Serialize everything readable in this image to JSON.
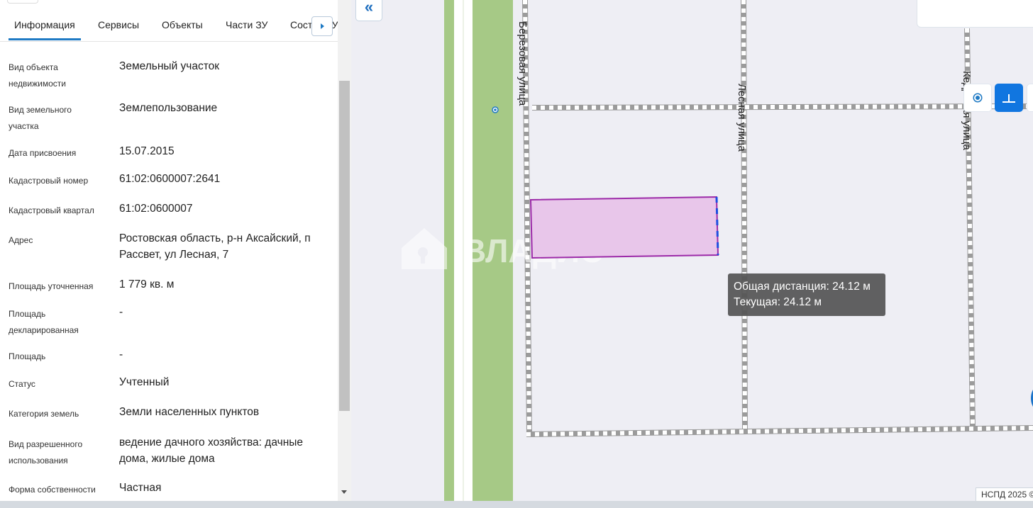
{
  "tabs": [
    {
      "label": "Информация"
    },
    {
      "label": "Сервисы"
    },
    {
      "label": "Объекты"
    },
    {
      "label": "Части ЗУ"
    },
    {
      "label": "Состав ЗУ"
    }
  ],
  "info": {
    "rows": [
      {
        "label": "Вид объекта недвижимости",
        "value": "Земельный участок"
      },
      {
        "label": "Вид земельного участка",
        "value": "Землепользование"
      },
      {
        "label": "Дата присвоения",
        "value": "15.07.2015"
      },
      {
        "label": "Кадастровый номер",
        "value": "61:02:0600007:2641"
      },
      {
        "label": "Кадастровый квартал",
        "value": "61:02:0600007"
      },
      {
        "label": "Адрес",
        "value": "Ростовская область, р-н Аксайский, п Рассвет, ул Лесная, 7"
      },
      {
        "label": "Площадь уточненная",
        "value": "1 779 кв. м"
      },
      {
        "label": "Площадь декларированная",
        "value": "-"
      },
      {
        "label": "Площадь",
        "value": "-"
      },
      {
        "label": "Статус",
        "value": "Учтенный"
      },
      {
        "label": "Категория земель",
        "value": "Земли населенных пунктов"
      },
      {
        "label": "Вид разрешенного использования",
        "value": "ведение дачного хозяйства: дачные дома, жилые дома"
      },
      {
        "label": "Форма собственности",
        "value": "Частная"
      }
    ]
  },
  "map": {
    "streets": [
      {
        "name": "Березовая улица"
      },
      {
        "name": "Лесная улица"
      },
      {
        "name": "Кедровая улица"
      }
    ],
    "watermark": "ВЛАДИС",
    "tooltip": {
      "total": "Общая дистанция: 24.12 м",
      "current": "Текущая: 24.12 м"
    },
    "attribution": "НСПД 2025 ©",
    "colors": {
      "parcel_fill": "#e8c6ea",
      "parcel_border": "#9c2aa8",
      "road_green": "#a6c986",
      "accent": "#1176e0"
    }
  },
  "icons": {
    "collapse": "double-chevron-left-icon",
    "tab_next": "arrow-right-icon",
    "locate": "locate-dot-icon",
    "measure": "ruler-measure-icon"
  }
}
